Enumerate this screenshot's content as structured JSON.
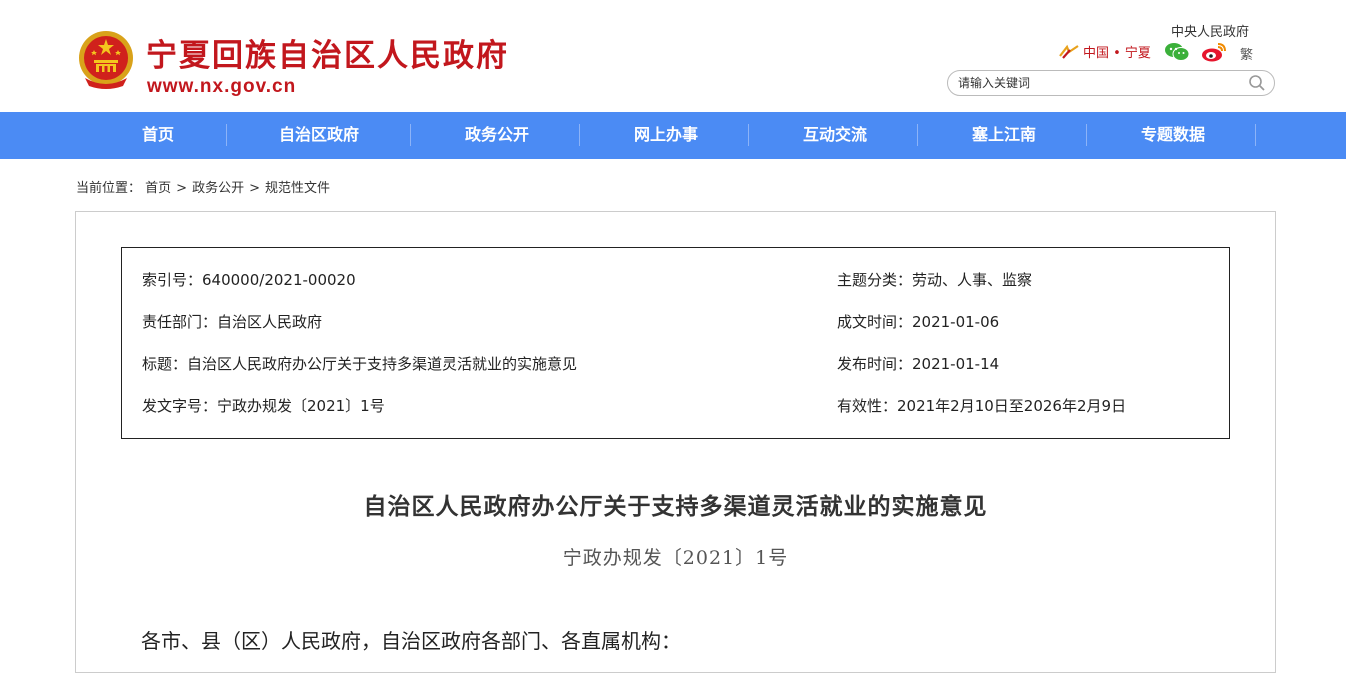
{
  "header": {
    "site_title": "宁夏回族自治区人民政府",
    "site_url": "www.nx.gov.cn",
    "central_gov_link": "中央人民政府",
    "china_ningxia": "中国 • 宁夏",
    "traditional": "繁",
    "search_placeholder": "请输入关键词",
    "brand_color": "#c2171d"
  },
  "nav": {
    "color": "#4b8bf4",
    "items": [
      {
        "label": "首页"
      },
      {
        "label": "自治区政府"
      },
      {
        "label": "政务公开"
      },
      {
        "label": "网上办事"
      },
      {
        "label": "互动交流"
      },
      {
        "label": "塞上江南"
      },
      {
        "label": "专题数据"
      }
    ]
  },
  "breadcrumb": {
    "prefix": "当前位置：",
    "items": [
      "首页",
      "政务公开",
      "规范性文件"
    ],
    "separator": ">"
  },
  "meta": {
    "index_no": "索引号：640000/2021-00020",
    "topic": "主题分类：劳动、人事、监察",
    "department": "责任部门：自治区人民政府",
    "created": "成文时间：2021-01-06",
    "title": "标题：自治区人民政府办公厅关于支持多渠道灵活就业的实施意见",
    "published": "发布时间：2021-01-14",
    "doc_no": "发文字号：宁政办规发〔2021〕1号",
    "validity": "有效性：2021年2月10日至2026年2月9日"
  },
  "document": {
    "title": "自治区人民政府办公厅关于支持多渠道灵活就业的实施意见",
    "number": "宁政办规发〔2021〕1号",
    "salutation": "各市、县（区）人民政府，自治区政府各部门、各直属机构："
  }
}
